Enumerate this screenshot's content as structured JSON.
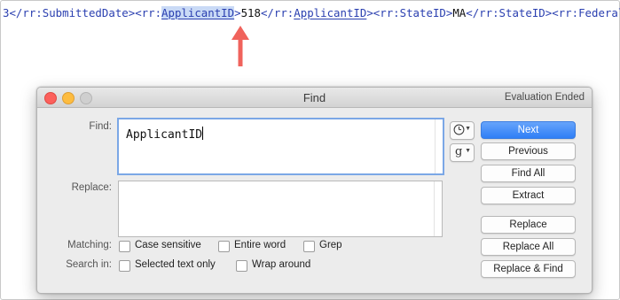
{
  "xml_line": {
    "segments": [
      {
        "text": "3</rr:SubmittedDate><rr:",
        "style": "tag"
      },
      {
        "text": "ApplicantID",
        "style": "highlight"
      },
      {
        "text": ">",
        "style": "tag"
      },
      {
        "text": "518",
        "style": "value"
      },
      {
        "text": "</rr:",
        "style": "tag"
      },
      {
        "text": "ApplicantID",
        "style": "underline"
      },
      {
        "text": "><rr:StateID>",
        "style": "tag"
      },
      {
        "text": "MA",
        "style": "value"
      },
      {
        "text": "</rr:StateID><rr:FederalID>",
        "style": "tag"
      }
    ]
  },
  "colors": {
    "tag_text": "#2a3fb0",
    "highlight_bg": "#c9daf6",
    "arrow": "#f0635c",
    "primary_button": "#2f7ff6"
  },
  "window": {
    "title": "Find",
    "status": "Evaluation Ended"
  },
  "labels": {
    "find": "Find:",
    "replace": "Replace:",
    "matching": "Matching:",
    "search_in": "Search in:"
  },
  "find_field": {
    "value": "ApplicantID"
  },
  "replace_field": {
    "value": ""
  },
  "popups": {
    "recent": {
      "icon": "clock-icon"
    },
    "grep": {
      "label": "g"
    }
  },
  "buttons": {
    "next": "Next",
    "previous": "Previous",
    "find_all": "Find All",
    "extract": "Extract",
    "replace": "Replace",
    "replace_all": "Replace All",
    "replace_find": "Replace & Find"
  },
  "options": {
    "case_sensitive": {
      "label": "Case sensitive",
      "checked": false
    },
    "entire_word": {
      "label": "Entire word",
      "checked": false
    },
    "grep": {
      "label": "Grep",
      "checked": false
    },
    "selected_text_only": {
      "label": "Selected text only",
      "checked": false
    },
    "wrap_around": {
      "label": "Wrap around",
      "checked": false
    }
  }
}
